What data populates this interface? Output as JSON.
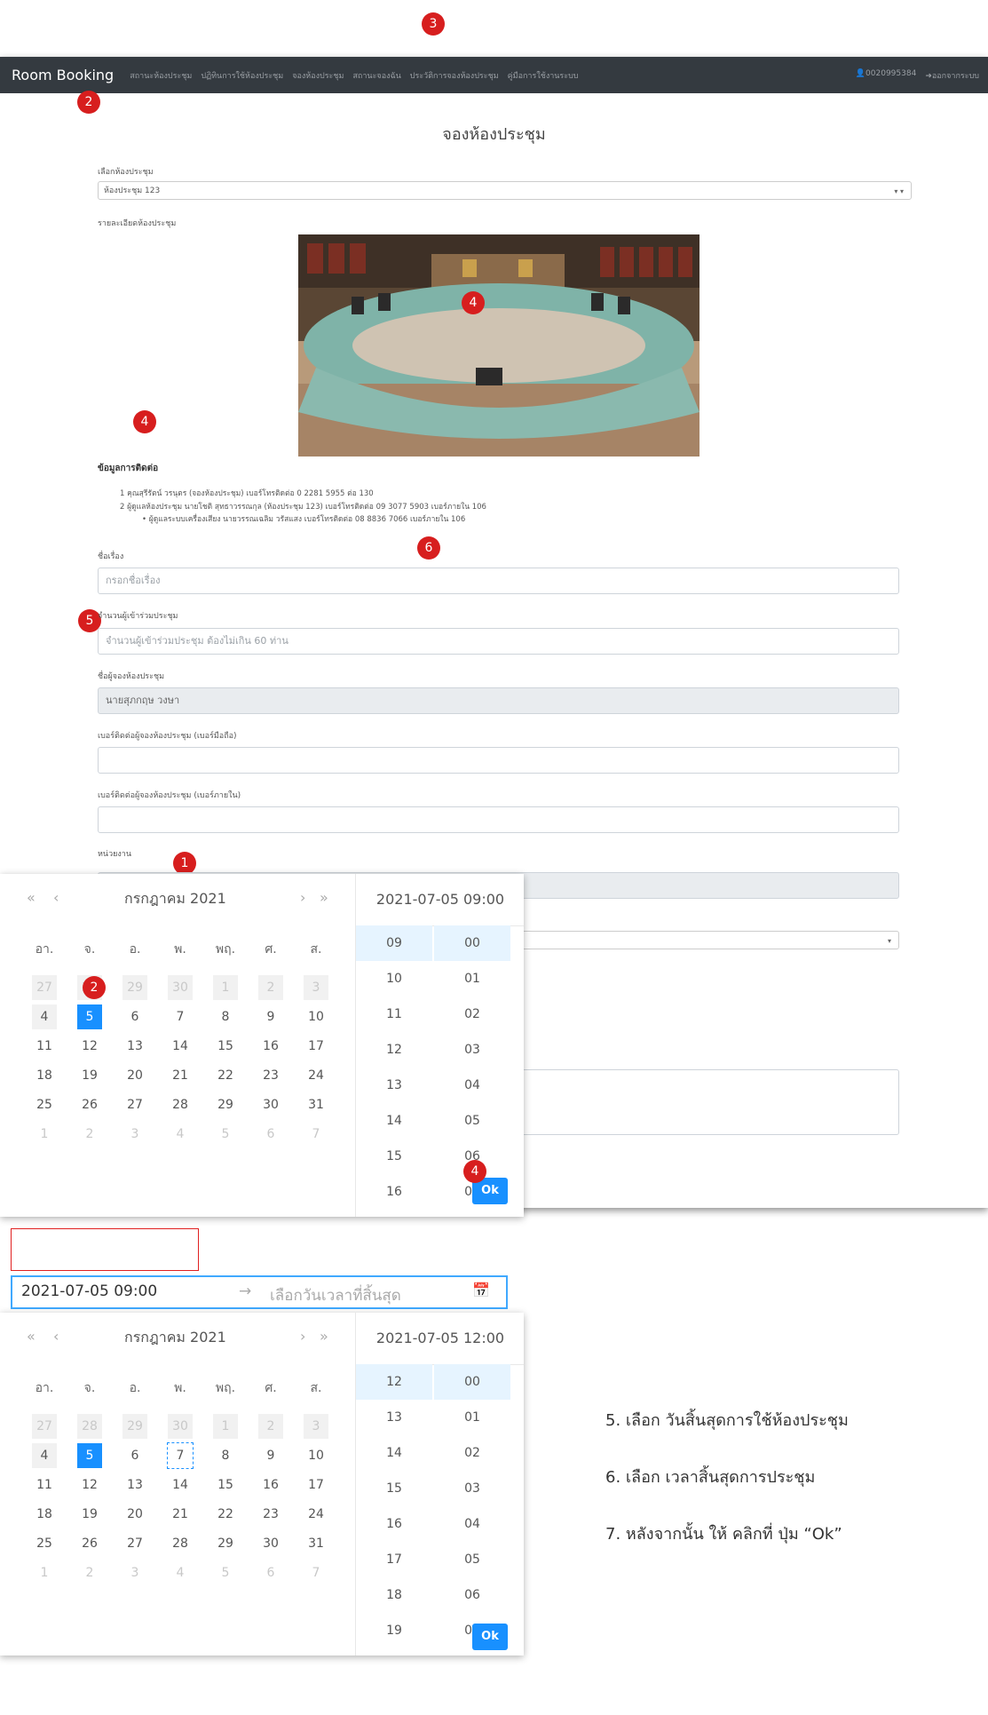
{
  "badges": [
    "3",
    "2",
    "4",
    "4",
    "6",
    "5",
    "1",
    "2",
    "4"
  ],
  "navbar": {
    "brand": "Room Booking",
    "links": [
      "สถานะห้องประชุม",
      "ปฏิทินการใช้ห้องประชุม",
      "จองห้องประชุม",
      "สถานะจองฉัน",
      "ประวัติการจองห้องประชุม",
      "คู่มือการใช้งานระบบ"
    ],
    "user": "0020995384",
    "logout": "ออกจากระบบ"
  },
  "page": {
    "title": "จองห้องประชุม",
    "room_label": "เลือกห้องประชุม",
    "room_value": "ห้องประชุม 123",
    "detail_label": "รายละเอียดห้องประชุม",
    "contact_title": "ข้อมูลการติดต่อ",
    "contacts": [
      "1 คุณสุรีรัตน์ วรนุตร (จองห้องประชุม) เบอร์โทรติดต่อ 0 2281 5955 ต่อ 130",
      "2 ผู้ดูแลห้องประชุม นายโชติ สุทธาวรรณกุล (ห้องประชุม 123) เบอร์โทรติดต่อ 09 3077 5903 เบอร์ภายใน 106",
      "ผู้ดูแลระบบเครื่องเสียง นายวรรณเฉลิม วรัสแสง เบอร์โทรติดต่อ 08 8836 7066 เบอร์ภายใน 106"
    ],
    "topic_label": "ชื่อเรื่อง",
    "topic_placeholder": "กรอกชื่อเรื่อง",
    "count_label": "จำนวนผู้เข้าร่วมประชุม",
    "count_placeholder": "จำนวนผู้เข้าร่วมประชุม ต้องไม่เกิน 60 ท่าน",
    "booker_label": "ชื่อผู้จองห้องประชุม",
    "booker_value": "นายสุภกฤษ วงษา",
    "mobile_label": "เบอร์ติดต่อผู้จองห้องประชุม (เบอร์มือถือ)",
    "ext_label": "เบอร์ติดต่อผู้จองห้องประชุม (เบอร์ภายใน)",
    "unit_label": "หน่วยงาน"
  },
  "picker1": {
    "month": "กรกฎาคม  2021",
    "time_header": "2021-07-05 09:00",
    "weekdays": [
      "อา.",
      "จ.",
      "อ.",
      "พ.",
      "พฤ.",
      "ศ.",
      "ส."
    ],
    "days": [
      "27",
      "28",
      "29",
      "30",
      "1",
      "2",
      "3",
      "4",
      "5",
      "6",
      "7",
      "8",
      "9",
      "10",
      "11",
      "12",
      "13",
      "14",
      "15",
      "16",
      "17",
      "18",
      "19",
      "20",
      "21",
      "22",
      "23",
      "24",
      "25",
      "26",
      "27",
      "28",
      "29",
      "30",
      "31",
      "1",
      "2",
      "3",
      "4",
      "5",
      "6",
      "7"
    ],
    "hours": [
      "09",
      "10",
      "11",
      "12",
      "13",
      "14",
      "15",
      "16"
    ],
    "minutes": [
      "00",
      "01",
      "02",
      "03",
      "04",
      "05",
      "06",
      "07"
    ],
    "ok": "Ok"
  },
  "range": {
    "start": "2021-07-05 09:00",
    "arrow": "→",
    "end_placeholder": "เลือกวันเวลาที่สิ้นสุด"
  },
  "picker2": {
    "month": "กรกฎาคม  2021",
    "time_header": "2021-07-05 12:00",
    "weekdays": [
      "อา.",
      "จ.",
      "อ.",
      "พ.",
      "พฤ.",
      "ศ.",
      "ส."
    ],
    "days": [
      "27",
      "28",
      "29",
      "30",
      "1",
      "2",
      "3",
      "4",
      "5",
      "6",
      "7",
      "8",
      "9",
      "10",
      "11",
      "12",
      "13",
      "14",
      "15",
      "16",
      "17",
      "18",
      "19",
      "20",
      "21",
      "22",
      "23",
      "24",
      "25",
      "26",
      "27",
      "28",
      "29",
      "30",
      "31",
      "1",
      "2",
      "3",
      "4",
      "5",
      "6",
      "7"
    ],
    "hours": [
      "12",
      "13",
      "14",
      "15",
      "16",
      "17",
      "18",
      "19"
    ],
    "minutes": [
      "00",
      "01",
      "02",
      "03",
      "04",
      "05",
      "06",
      "07"
    ],
    "ok": "Ok"
  },
  "steps": [
    "5.  เลือก วันสิ้นสุดการใช้ห้องประชุม",
    "6.  เลือก เวลาสิ้นสุดการประชุม",
    "7.  หลังจากนั้น ให้ คลิกที่ ปุ่ม “Ok”"
  ]
}
